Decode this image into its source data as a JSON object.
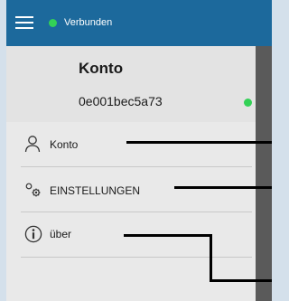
{
  "status": {
    "label": "Verbunden",
    "color": "#33d156"
  },
  "header": {
    "menu_icon": "hamburger-menu-icon",
    "background": "#1c699c"
  },
  "account": {
    "title": "Konto",
    "device_id": "0e001bec5a73",
    "status_color": "#33d156"
  },
  "menu": {
    "items": [
      {
        "label": "Konto",
        "icon": "person-icon"
      },
      {
        "label": "EINSTELLUNGEN",
        "icon": "gears-icon"
      },
      {
        "label": "über",
        "icon": "info-icon"
      }
    ]
  }
}
